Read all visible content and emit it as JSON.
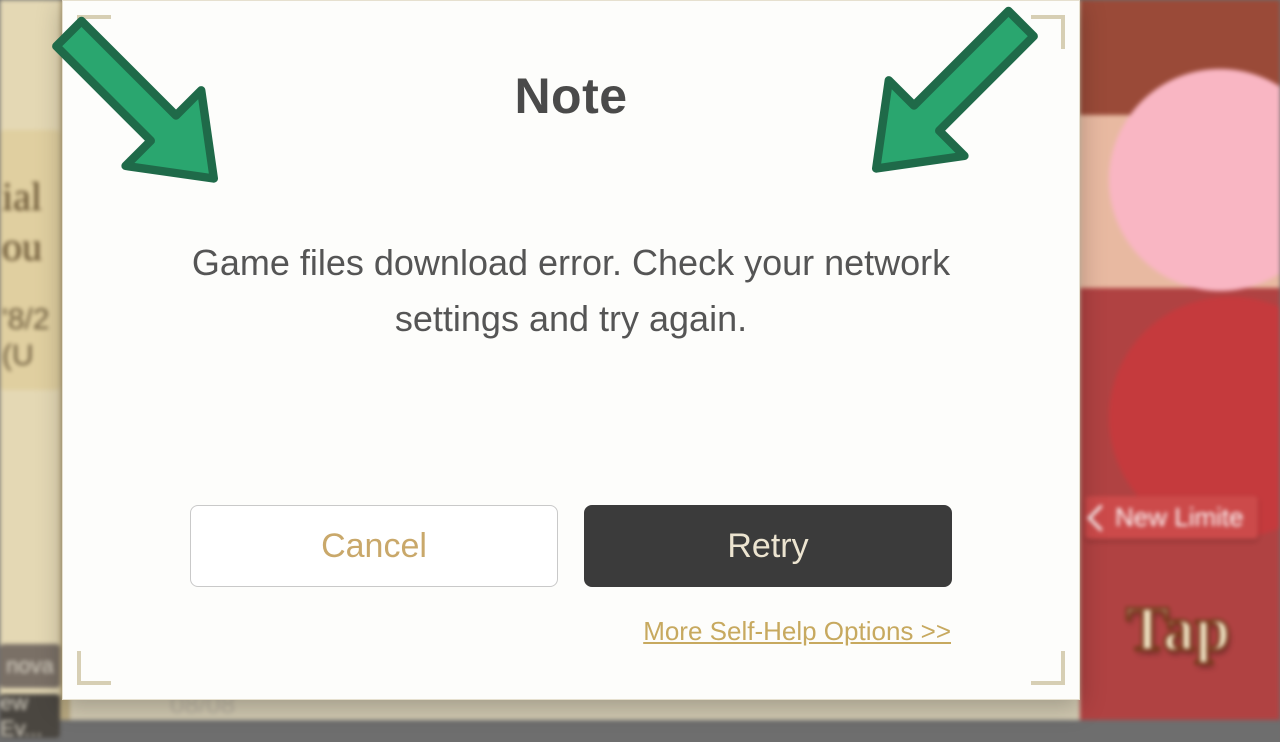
{
  "dialog": {
    "title": "Note",
    "message": "Game files download error. Check your network settings and try again.",
    "cancel_label": "Cancel",
    "retry_label": "Retry",
    "help_link": "More Self-Help Options >>"
  },
  "background": {
    "left_title_1": "ial",
    "left_title_2": "ou",
    "left_sub_1": "'8/2",
    "left_sub_2": "(U",
    "chip1": "nova",
    "chip2": "ew Ev...",
    "bottom_date": "08/08",
    "right_badge": "New Limite",
    "right_tap": "Tap"
  },
  "annotation": {
    "arrow_color": "#2aa66f",
    "arrow_stroke": "#1f6a49"
  }
}
